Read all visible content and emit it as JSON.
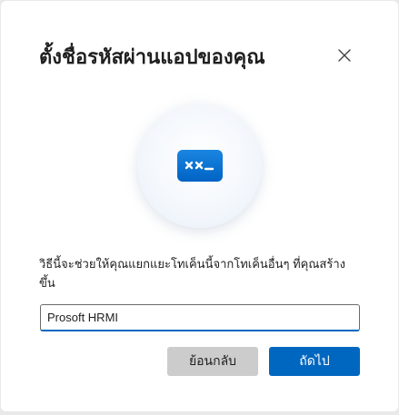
{
  "dialog": {
    "title": "ตั้งชื่อรหัสผ่านแอปของคุณ",
    "description": "วิธีนี้จะช่วยให้คุณแยกแยะโทเค็นนี้จากโทเค็นอื่นๆ ที่คุณสร้างขึ้น",
    "input_value": "Prosoft HRMI",
    "back_label": "ย้อนกลับ",
    "next_label": "ถัดไป",
    "close_icon": "close-icon",
    "hero_icon": "password-icon",
    "accent_color": "#0067c0"
  }
}
